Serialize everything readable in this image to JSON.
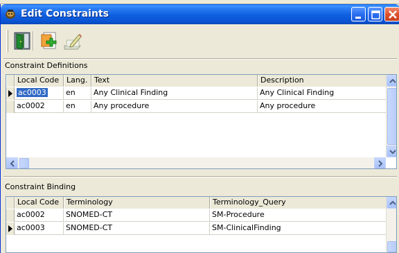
{
  "window": {
    "title": "Edit Constraints",
    "icon_name": "app-icon",
    "accent_color": "#0a55d4"
  },
  "top_strip_text": "~~~~~~~~~~~~",
  "toolbar": {
    "buttons": [
      {
        "name": "exit-icon"
      },
      {
        "name": "add-icon"
      },
      {
        "name": "edit-icon"
      }
    ]
  },
  "definitions": {
    "label": "Constraint Definitions",
    "columns": [
      "Local Code",
      "Lang.",
      "Text",
      "Description"
    ],
    "rows": [
      {
        "code": "ac0003",
        "lang": "en",
        "text": "Any Clinical Finding",
        "description": "Any Clinical Finding",
        "current": true
      },
      {
        "code": "ac0002",
        "lang": "en",
        "text": "Any procedure",
        "description": "Any procedure",
        "current": false
      }
    ]
  },
  "binding": {
    "label": "Constraint Binding",
    "columns": [
      "Local Code",
      "Terminology",
      "Terminology_Query"
    ],
    "rows": [
      {
        "code": "ac0002",
        "terminology": "SNOMED-CT",
        "query": "SM-Procedure",
        "current": false
      },
      {
        "code": "ac0003",
        "terminology": "SNOMED-CT",
        "query": "SM-ClinicalFinding",
        "current": true
      }
    ]
  }
}
